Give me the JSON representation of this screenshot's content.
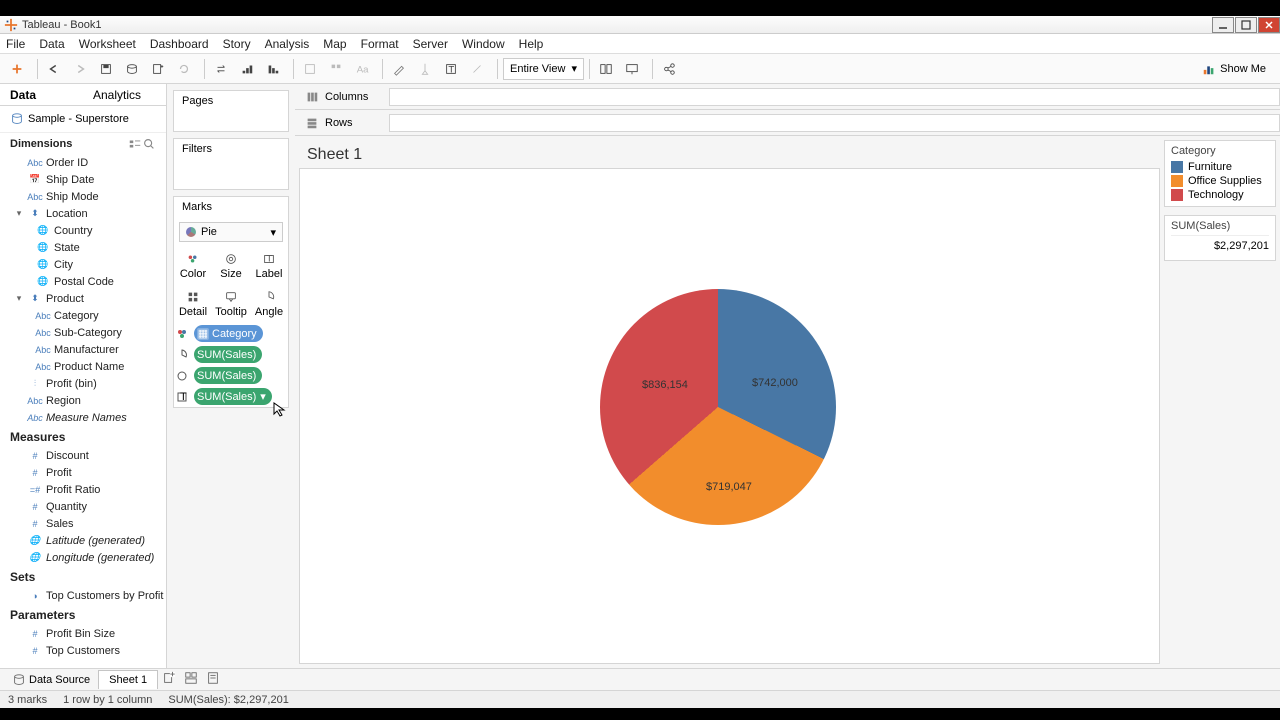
{
  "window": {
    "title": "Tableau - Book1"
  },
  "menu": [
    "File",
    "Data",
    "Worksheet",
    "Dashboard",
    "Story",
    "Analysis",
    "Map",
    "Format",
    "Server",
    "Window",
    "Help"
  ],
  "toolbar": {
    "view_mode": "Entire View",
    "show_me": "Show Me"
  },
  "data_pane": {
    "tabs": {
      "data": "Data",
      "analytics": "Analytics"
    },
    "data_source": "Sample - Superstore",
    "dimensions_label": "Dimensions",
    "dimensions_flat": [
      "Order ID",
      "Ship Date",
      "Ship Mode"
    ],
    "hier_location": "Location",
    "location_children": [
      "Country",
      "State",
      "City",
      "Postal Code"
    ],
    "hier_product": "Product",
    "product_children": [
      "Category",
      "Sub-Category",
      "Manufacturer",
      "Product Name"
    ],
    "dimensions_tail": [
      "Profit (bin)",
      "Region",
      "Measure Names"
    ],
    "measures_label": "Measures",
    "measures": [
      "Discount",
      "Profit",
      "Profit Ratio",
      "Quantity",
      "Sales",
      "Latitude (generated)",
      "Longitude (generated)"
    ],
    "sets_label": "Sets",
    "sets": [
      "Top Customers by Profit"
    ],
    "params_label": "Parameters",
    "params": [
      "Profit Bin Size",
      "Top Customers"
    ]
  },
  "shelves": {
    "pages": "Pages",
    "filters": "Filters",
    "marks": "Marks",
    "mark_type": "Pie",
    "mark_cells": {
      "color": "Color",
      "size": "Size",
      "label": "Label",
      "detail": "Detail",
      "tooltip": "Tooltip",
      "angle": "Angle"
    },
    "pills": [
      "Category",
      "SUM(Sales)",
      "SUM(Sales)",
      "SUM(Sales)"
    ]
  },
  "cols_label": "Columns",
  "rows_label": "Rows",
  "sheet_title": "Sheet 1",
  "legend": {
    "title": "Category",
    "items": [
      {
        "name": "Furniture",
        "color": "#4877a5"
      },
      {
        "name": "Office Supplies",
        "color": "#f28d2c"
      },
      {
        "name": "Technology",
        "color": "#d14a4c"
      }
    ],
    "sum_label": "SUM(Sales)",
    "sum_value": "$2,297,201"
  },
  "chart_data": {
    "type": "pie",
    "title": "Sheet 1",
    "categories": [
      "Furniture",
      "Office Supplies",
      "Technology"
    ],
    "values": [
      742000,
      719047,
      836154
    ],
    "labels": [
      "$742,000",
      "$719,047",
      "$836,154"
    ],
    "colors": [
      "#4877a5",
      "#f28d2c",
      "#d14a4c"
    ]
  },
  "tabs": {
    "data_source": "Data Source",
    "sheet": "Sheet 1"
  },
  "status": {
    "marks": "3 marks",
    "dims": "1 row by 1 column",
    "sum": "SUM(Sales): $2,297,201"
  }
}
